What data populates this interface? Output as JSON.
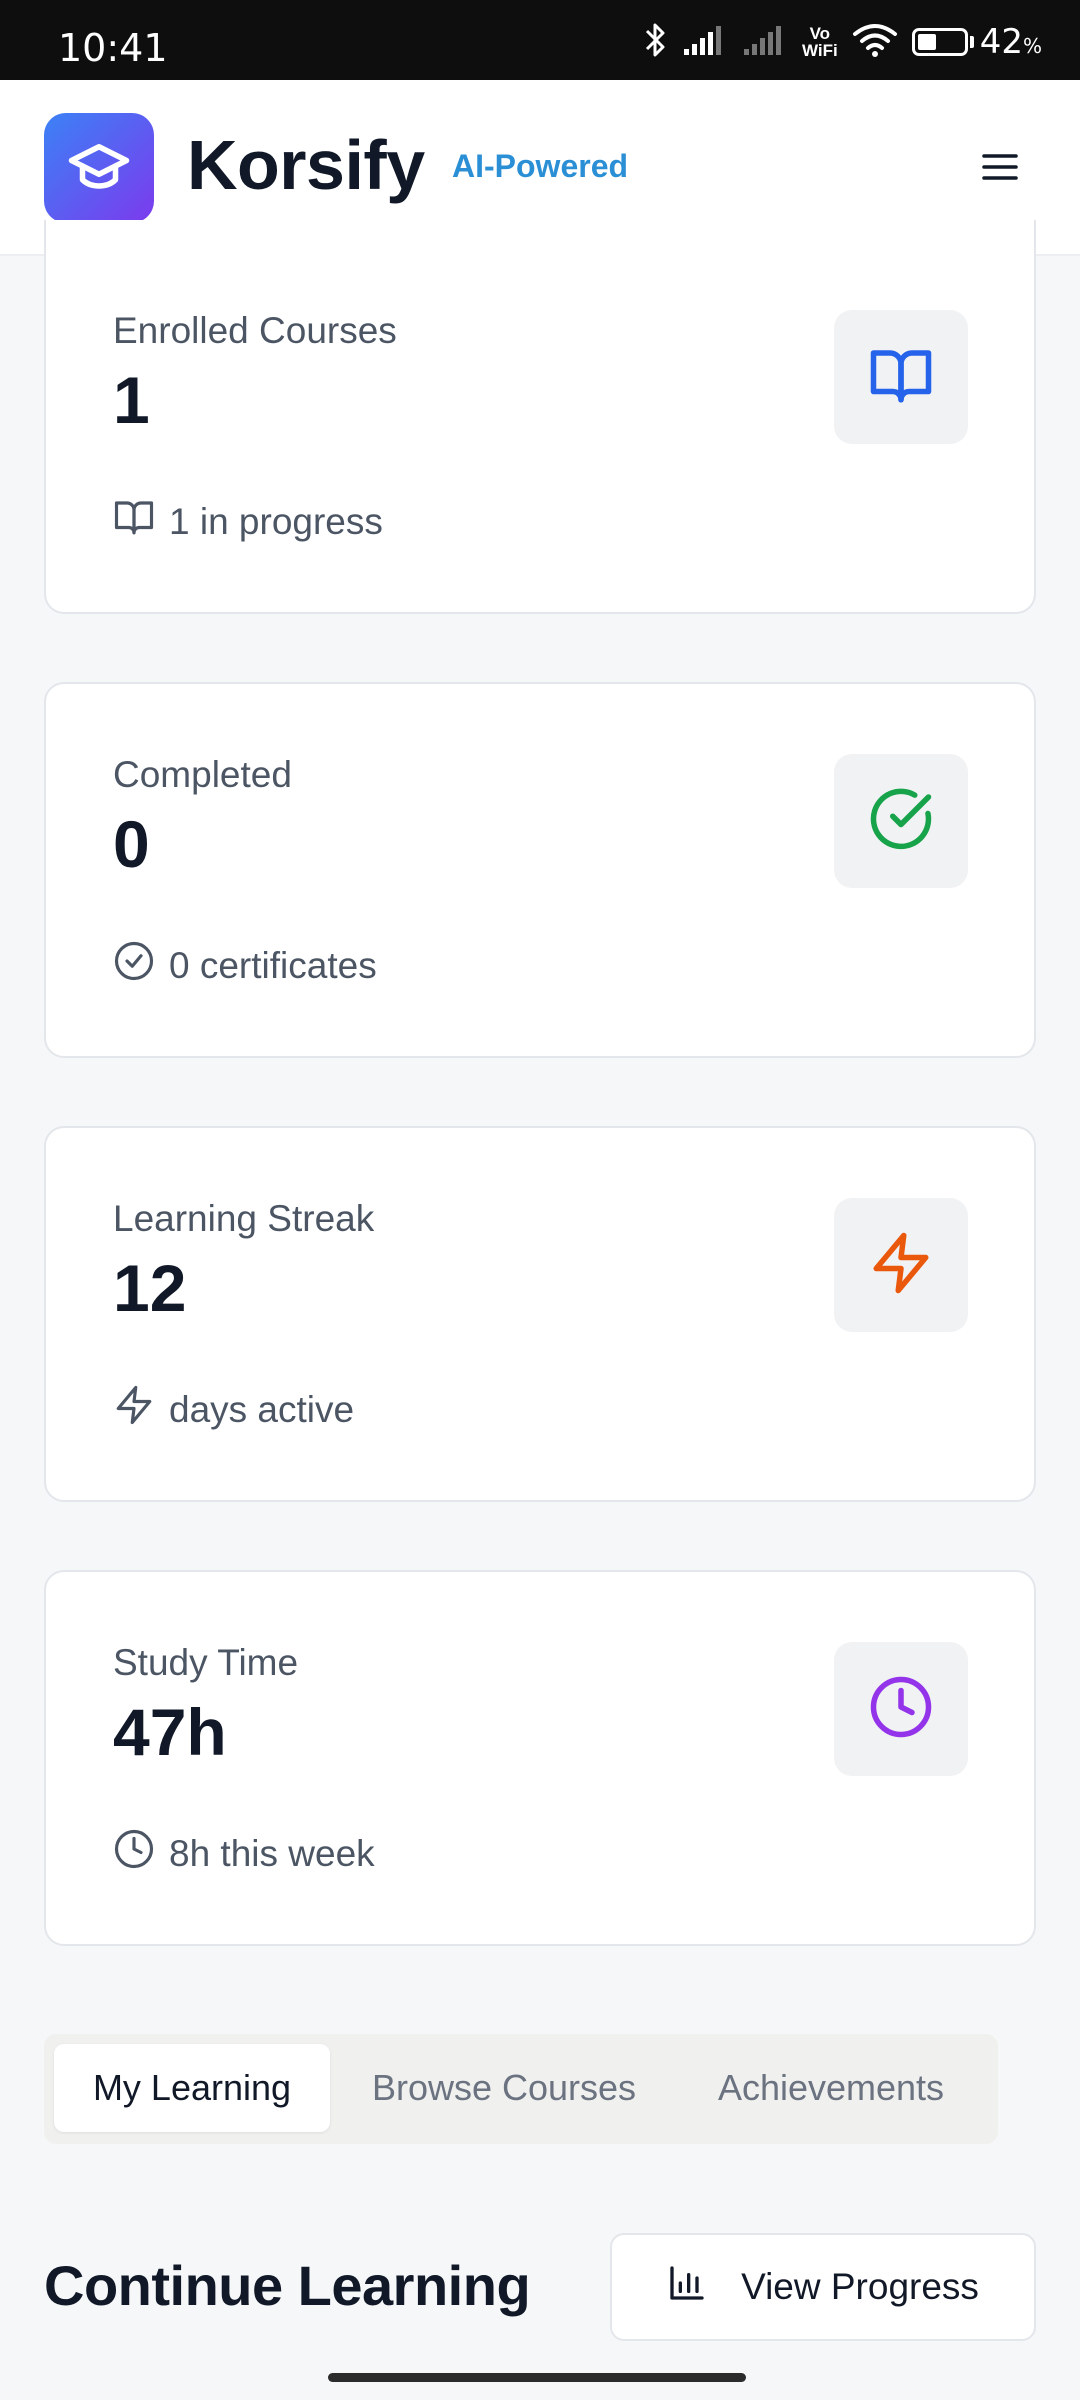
{
  "status_bar": {
    "time": "10:41",
    "vowifi_top": "Vo",
    "vowifi_bottom": "WiFi",
    "battery_percent": "42",
    "battery_unit": "%",
    "battery_level": 0.42,
    "icons": [
      "bluetooth-icon",
      "signal-icon",
      "signal-icon",
      "vowifi-icon",
      "wifi-icon",
      "battery-icon"
    ]
  },
  "header": {
    "app_name": "Korsify",
    "badge": "AI-Powered",
    "logo_icon": "graduation-cap-icon",
    "menu_icon": "hamburger-menu-icon",
    "colors": {
      "logo_gradient_start": "#3b82f6",
      "logo_gradient_end": "#7c3aed",
      "badge": "#2b8fd6"
    }
  },
  "stats": [
    {
      "label": "Enrolled Courses",
      "value": "1",
      "sub": "1 in progress",
      "icon": "book-open-icon",
      "color": "#2563eb"
    },
    {
      "label": "Completed",
      "value": "0",
      "sub": "0 certificates",
      "icon": "check-circle-icon",
      "color": "#16a34a"
    },
    {
      "label": "Learning Streak",
      "value": "12",
      "sub": "days active",
      "icon": "zap-icon",
      "color": "#ea580c"
    },
    {
      "label": "Study Time",
      "value": "47h",
      "sub": "8h this week",
      "icon": "clock-icon",
      "color": "#9333ea"
    }
  ],
  "tabs": [
    {
      "label": "My Learning",
      "active": true
    },
    {
      "label": "Browse Courses",
      "active": false
    },
    {
      "label": "Achievements",
      "active": false
    }
  ],
  "continue_section": {
    "title": "Continue Learning",
    "button_label": "View Progress",
    "button_icon": "bar-chart-icon"
  }
}
